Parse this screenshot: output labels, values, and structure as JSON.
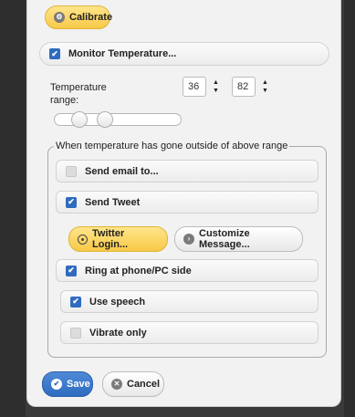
{
  "buttons": {
    "calibrate": "Calibrate",
    "twitter_login": "Twitter Login...",
    "customize_message": "Customize Message...",
    "save": "Save",
    "cancel": "Cancel"
  },
  "monitor": {
    "label": "Monitor Temperature...",
    "checked": true
  },
  "temperature": {
    "label_line1": "Temperature",
    "label_line2": "range:",
    "min": "36",
    "max": "82",
    "slider_values": [
      36,
      82
    ]
  },
  "alerts": {
    "legend": "When temperature has gone outside of above range",
    "send_email": {
      "label": "Send email to...",
      "checked": false
    },
    "send_tweet": {
      "label": "Send Tweet",
      "checked": true
    },
    "ring": {
      "label": "Ring at phone/PC side",
      "checked": true
    },
    "use_speech": {
      "label": "Use speech",
      "checked": true
    },
    "vibrate_only": {
      "label": "Vibrate only",
      "checked": false
    }
  },
  "icons": {
    "calibrate": "gear-icon",
    "twitter": "radio-icon",
    "customize": "chevron-right-icon",
    "save": "checkmark-icon",
    "cancel": "close-icon"
  },
  "colors": {
    "accent_blue": "#2f6bbf",
    "highlight_yellow": "#f7c948"
  }
}
